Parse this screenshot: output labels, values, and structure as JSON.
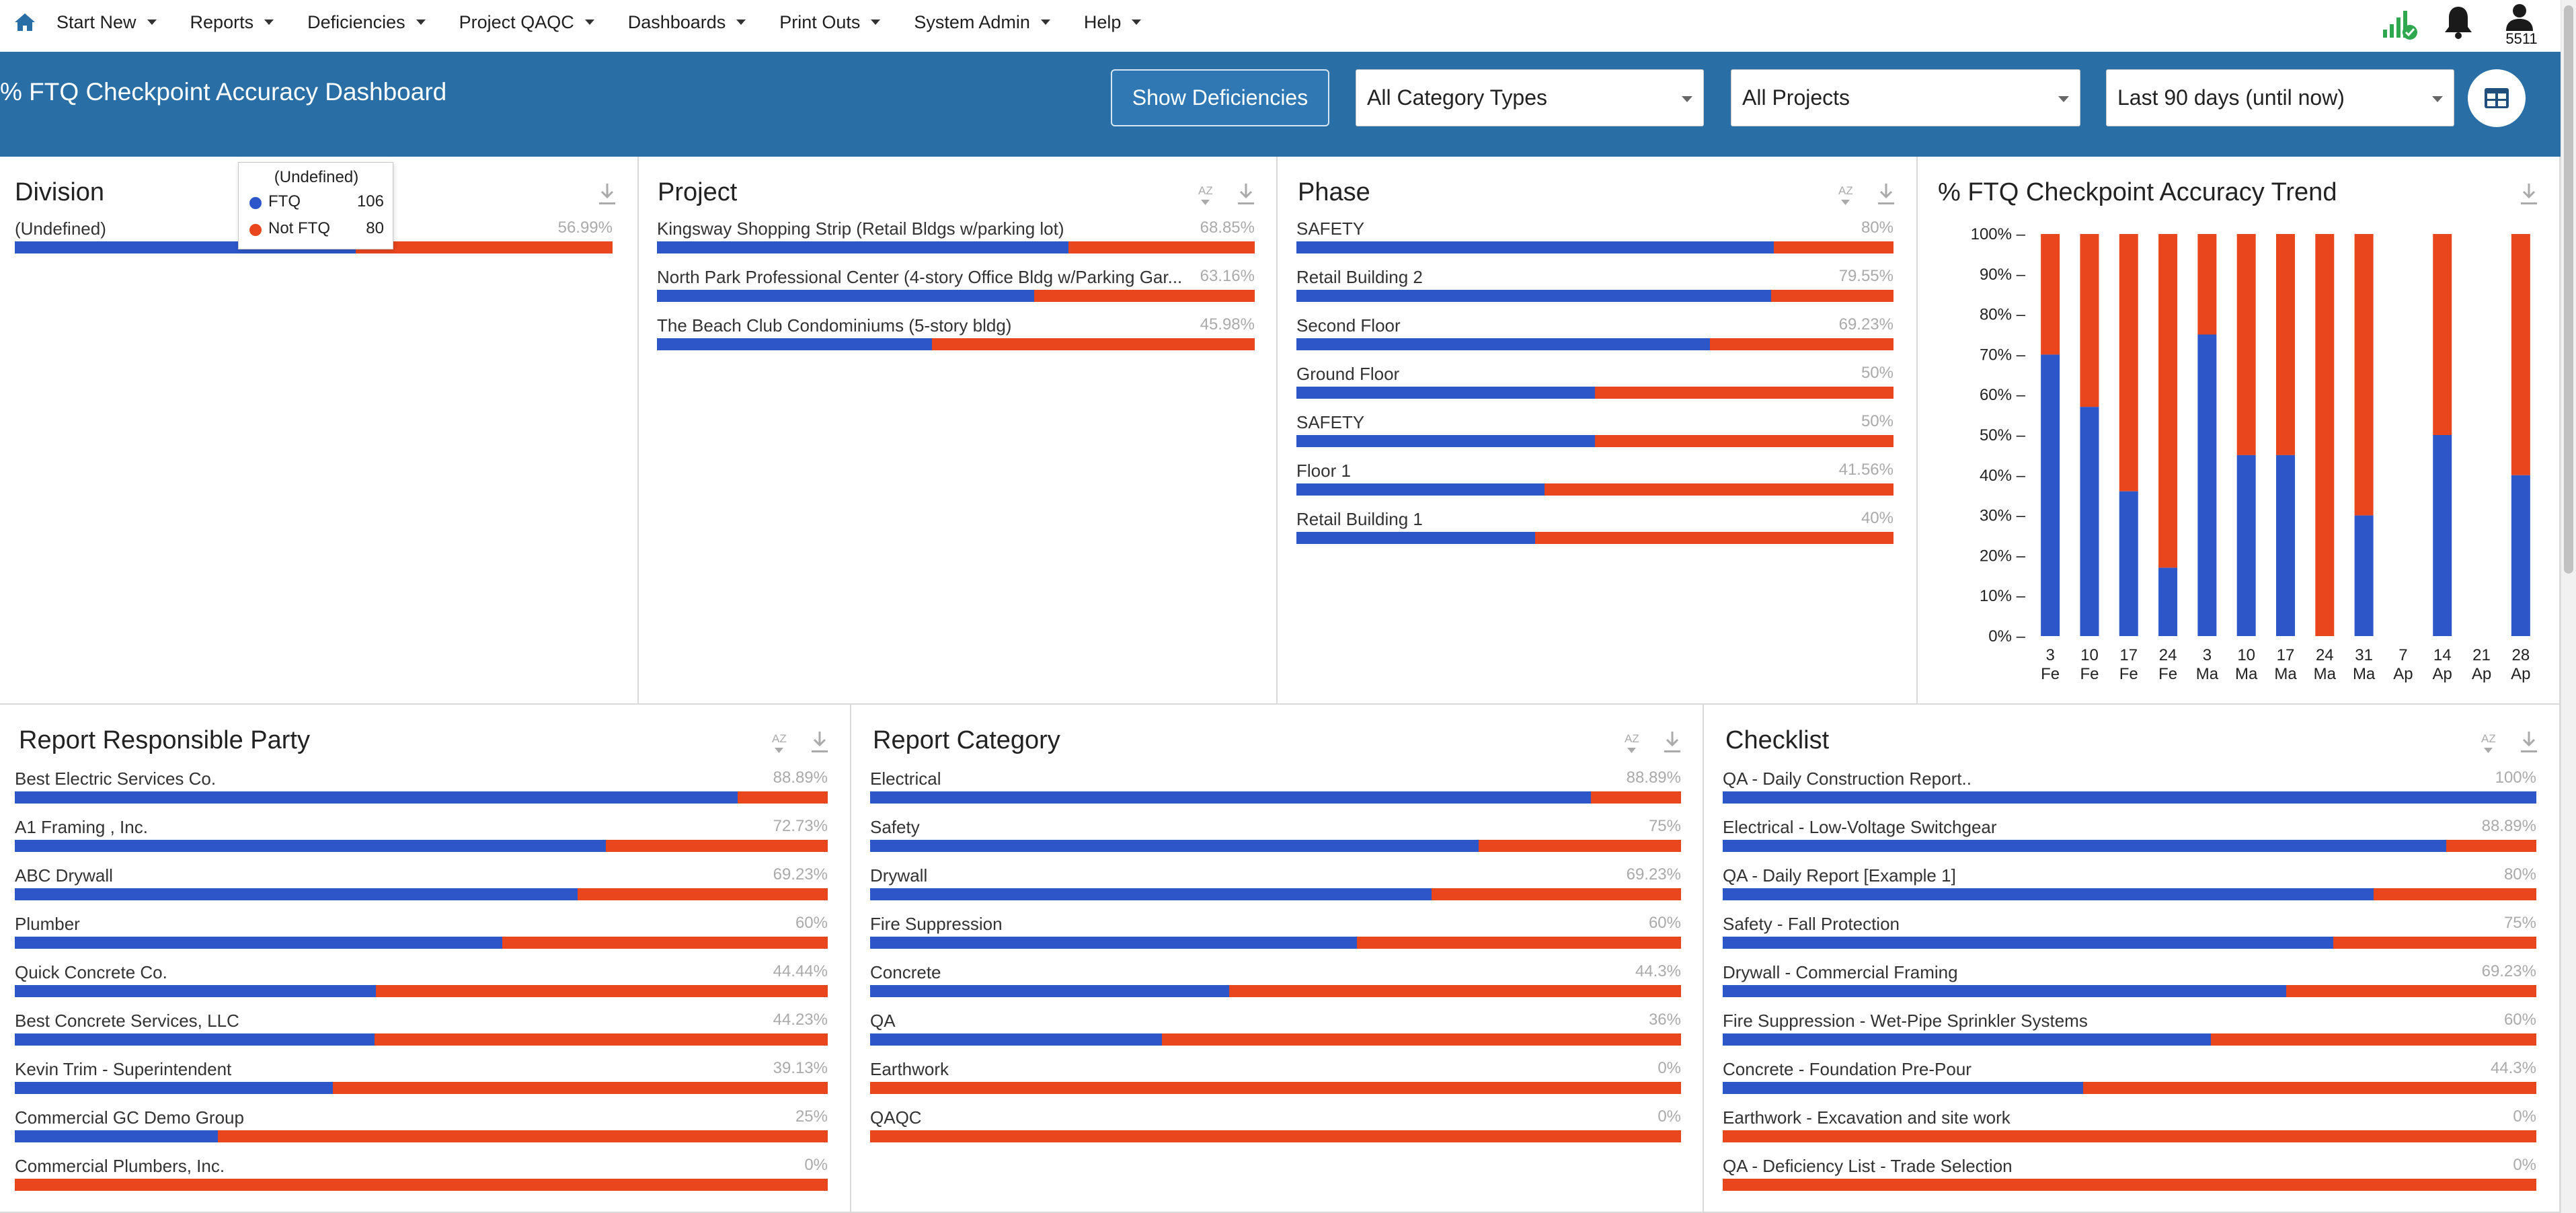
{
  "nav": {
    "items": [
      {
        "label": "Start New"
      },
      {
        "label": "Reports"
      },
      {
        "label": "Deficiencies"
      },
      {
        "label": "Project QAQC"
      },
      {
        "label": "Dashboards"
      },
      {
        "label": "Print Outs"
      },
      {
        "label": "System Admin"
      },
      {
        "label": "Help"
      }
    ],
    "user_id": "5511",
    "icons": [
      "home-icon",
      "signal-icon",
      "bell-icon",
      "user-icon"
    ]
  },
  "header": {
    "title": "% FTQ Checkpoint Accuracy Dashboard",
    "show_deficiencies": "Show Deficiencies",
    "category_select": "All Category Types",
    "project_select": "All Projects",
    "date_select": "Last 90 days (until now)",
    "accent_color": "#2a6ea6"
  },
  "colors": {
    "ftq": "#2d56c9",
    "not_ftq": "#e9461e"
  },
  "tooltip": {
    "title": "(Undefined)",
    "rows": [
      {
        "name": "FTQ",
        "value": "106"
      },
      {
        "name": "Not FTQ",
        "value": "80"
      }
    ]
  },
  "panels": {
    "division": {
      "title": "Division",
      "rows": [
        {
          "label": "(Undefined)",
          "pct": "56.99%",
          "value": 56.99
        }
      ]
    },
    "project": {
      "title": "Project",
      "rows": [
        {
          "label": "Kingsway Shopping Strip (Retail Bldgs w/parking lot)",
          "pct": "68.85%",
          "value": 68.85
        },
        {
          "label": "North Park Professional Center (4-story Office Bldg w/Parking Gar...",
          "pct": "63.16%",
          "value": 63.16
        },
        {
          "label": "The Beach Club Condominiums (5-story bldg)",
          "pct": "45.98%",
          "value": 45.98
        }
      ]
    },
    "phase": {
      "title": "Phase",
      "rows": [
        {
          "label": "SAFETY",
          "pct": "80%",
          "value": 80
        },
        {
          "label": "Retail Building 2",
          "pct": "79.55%",
          "value": 79.55
        },
        {
          "label": "Second Floor",
          "pct": "69.23%",
          "value": 69.23
        },
        {
          "label": "Ground Floor",
          "pct": "50%",
          "value": 50
        },
        {
          "label": "SAFETY",
          "pct": "50%",
          "value": 50
        },
        {
          "label": "Floor 1",
          "pct": "41.56%",
          "value": 41.56
        },
        {
          "label": "Retail Building 1",
          "pct": "40%",
          "value": 40
        }
      ]
    },
    "responsible": {
      "title": "Report Responsible Party",
      "rows": [
        {
          "label": "Best Electric Services Co.",
          "pct": "88.89%",
          "value": 88.89
        },
        {
          "label": "A1 Framing , Inc.",
          "pct": "72.73%",
          "value": 72.73
        },
        {
          "label": "ABC Drywall",
          "pct": "69.23%",
          "value": 69.23
        },
        {
          "label": "Plumber",
          "pct": "60%",
          "value": 60
        },
        {
          "label": "Quick Concrete Co.",
          "pct": "44.44%",
          "value": 44.44
        },
        {
          "label": "Best Concrete Services, LLC",
          "pct": "44.23%",
          "value": 44.23
        },
        {
          "label": "Kevin Trim - Superintendent",
          "pct": "39.13%",
          "value": 39.13
        },
        {
          "label": "Commercial GC Demo Group",
          "pct": "25%",
          "value": 25
        },
        {
          "label": "Commercial Plumbers, Inc.",
          "pct": "0%",
          "value": 0
        }
      ]
    },
    "category": {
      "title": "Report Category",
      "rows": [
        {
          "label": "Electrical",
          "pct": "88.89%",
          "value": 88.89
        },
        {
          "label": "Safety",
          "pct": "75%",
          "value": 75
        },
        {
          "label": "Drywall",
          "pct": "69.23%",
          "value": 69.23
        },
        {
          "label": "Fire Suppression",
          "pct": "60%",
          "value": 60
        },
        {
          "label": "Concrete",
          "pct": "44.3%",
          "value": 44.3
        },
        {
          "label": "QA",
          "pct": "36%",
          "value": 36
        },
        {
          "label": "Earthwork",
          "pct": "0%",
          "value": 0
        },
        {
          "label": "QAQC",
          "pct": "0%",
          "value": 0
        }
      ]
    },
    "checklist": {
      "title": "Checklist",
      "rows": [
        {
          "label": "QA - Daily Construction Report..",
          "pct": "100%",
          "value": 100
        },
        {
          "label": "Electrical - Low-Voltage Switchgear",
          "pct": "88.89%",
          "value": 88.89
        },
        {
          "label": "QA - Daily Report [Example 1]",
          "pct": "80%",
          "value": 80
        },
        {
          "label": "Safety - Fall Protection",
          "pct": "75%",
          "value": 75
        },
        {
          "label": "Drywall - Commercial Framing",
          "pct": "69.23%",
          "value": 69.23
        },
        {
          "label": "Fire Suppression - Wet-Pipe Sprinkler Systems",
          "pct": "60%",
          "value": 60
        },
        {
          "label": "Concrete - Foundation Pre-Pour",
          "pct": "44.3%",
          "value": 44.3
        },
        {
          "label": "Earthwork - Excavation and site work",
          "pct": "0%",
          "value": 0
        },
        {
          "label": "QA - Deficiency List - Trade Selection",
          "pct": "0%",
          "value": 0
        }
      ]
    }
  },
  "chart_data": {
    "type": "bar",
    "title": "% FTQ Checkpoint Accuracy Trend",
    "stacked": true,
    "categories": [
      [
        "3",
        "Fe"
      ],
      [
        "10",
        "Fe"
      ],
      [
        "17",
        "Fe"
      ],
      [
        "24",
        "Fe"
      ],
      [
        "3",
        "Ma"
      ],
      [
        "10",
        "Ma"
      ],
      [
        "17",
        "Ma"
      ],
      [
        "24",
        "Ma"
      ],
      [
        "31",
        "Ma"
      ],
      [
        "7",
        "Ap"
      ],
      [
        "14",
        "Ap"
      ],
      [
        "21",
        "Ap"
      ],
      [
        "28",
        "Ap"
      ]
    ],
    "y_ticks": [
      "0% –",
      "10% –",
      "20% –",
      "30% –",
      "40% –",
      "50% –",
      "60% –",
      "70% –",
      "80% –",
      "90% –",
      "100% –"
    ],
    "ylim": [
      0,
      100
    ],
    "series": [
      {
        "values": [
          70,
          57,
          36,
          17,
          75,
          45,
          45,
          0,
          30,
          null,
          50,
          null,
          40
        ]
      },
      {
        "values": [
          30,
          43,
          64,
          83,
          25,
          55,
          55,
          100,
          70,
          null,
          50,
          null,
          60
        ]
      }
    ]
  }
}
